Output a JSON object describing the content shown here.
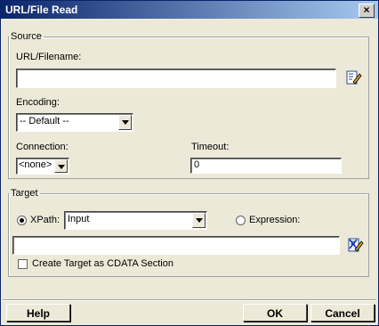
{
  "window": {
    "title": "URL/File Read",
    "close_glyph": "×"
  },
  "source": {
    "legend": "Source",
    "url_label": "URL/Filename:",
    "url_value": "",
    "encoding_label": "Encoding:",
    "encoding_value": "-- Default --",
    "connection_label": "Connection:",
    "connection_value": "<none>",
    "timeout_label": "Timeout:",
    "timeout_value": "0"
  },
  "target": {
    "legend": "Target",
    "xpath_label": "XPath:",
    "xpath_value": "Input",
    "xpath_selected": true,
    "expression_label": "Expression:",
    "expression_selected": false,
    "target_value": "",
    "cdata_label": "Create Target as CDATA Section",
    "cdata_checked": false
  },
  "buttons": {
    "help": "Help",
    "ok": "OK",
    "cancel": "Cancel"
  },
  "icons": {
    "url_edit": "edit-icon",
    "target_edit": "edit-clear-icon"
  }
}
